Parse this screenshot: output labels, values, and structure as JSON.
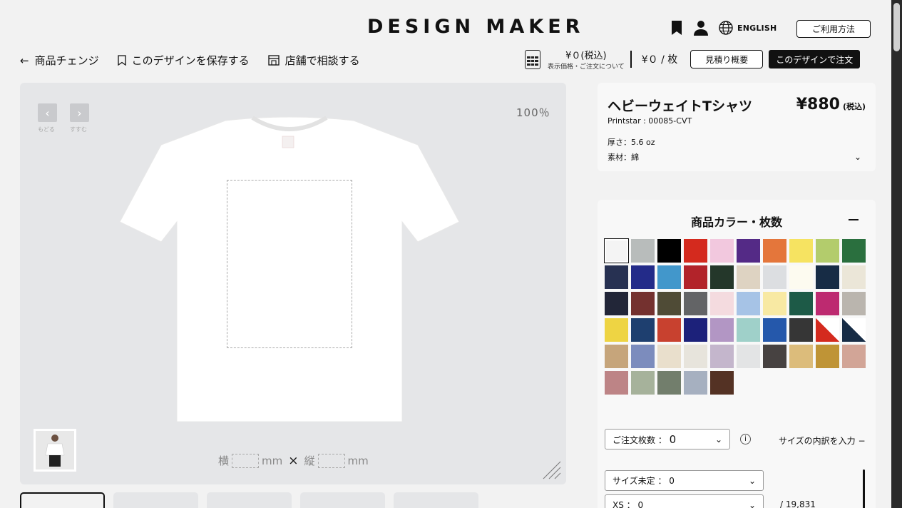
{
  "header": {
    "logo": "DESIGN MAKER",
    "language": "ENGLISH",
    "help_label": "ご利用方法"
  },
  "nav": {
    "change_product": "商品チェンジ",
    "save_design": "このデザインを保存する",
    "consult_store": "店舗で相談する"
  },
  "pricing": {
    "total": "¥０(税込)",
    "note": "表示価格・ご注文について",
    "per_item": "¥０ / 枚",
    "estimate_label": "見積り概要",
    "order_label": "このデザインで注文"
  },
  "canvas": {
    "undo_label": "もどる",
    "redo_label": "すすむ",
    "zoom": "100％",
    "width_label": "横",
    "height_label": "縦",
    "unit": "mm",
    "times": "×"
  },
  "product": {
    "name": "ヘビーウェイトTシャツ",
    "price": "¥880",
    "tax": "(税込)",
    "code": "Printstar : 00085-CVT",
    "thickness": "厚さ：5.6 oz",
    "material": "素材：綿"
  },
  "colors": {
    "title": "商品カラー・枚数",
    "swatches": [
      "#f4f4f4",
      "#b8bcbb",
      "#000000",
      "#d42a1e",
      "#f2c8de",
      "#542a86",
      "#e4763b",
      "#f6e361",
      "#b3cc6c",
      "#2a6f3e",
      "#273152",
      "#232b89",
      "#4297cb",
      "#b2232a",
      "#24372a",
      "#ded3c2",
      "#dcdee1",
      "#fdfbf0",
      "#172c45",
      "#ebe6d8",
      "#222638",
      "#74312f",
      "#4f4b36",
      "#636466",
      "#f4dbdf",
      "#a6c3e6",
      "#f8e9a3",
      "#1d5a47",
      "#bd2a70",
      "#bab5ae",
      "#eed443",
      "#1e3f6f",
      "#c8412f",
      "#1c217a",
      "#b296c4",
      "#9fd0c9",
      "#2558ab",
      "#363636",
      "split-red",
      "split-navy",
      "#c6a57b",
      "#7c8cbd",
      "#e9dfcc",
      "#e7e4dc",
      "#c4b6cc",
      "#e3e4e5",
      "#474241",
      "#dcbc7b",
      "#bf9436",
      "#d2a597",
      "#bd8486",
      "#a6b29b",
      "#727e6c",
      "#a6b0c0",
      "#543224"
    ]
  },
  "order": {
    "qty_label": "ご注文枚数 ：",
    "qty_value": "0",
    "info": "i",
    "size_breakdown": "サイズの内訳を入力 −",
    "size_undecided": "サイズ未定 ： 0",
    "xs": "XS ： 0",
    "stock": "/ 19,831"
  }
}
